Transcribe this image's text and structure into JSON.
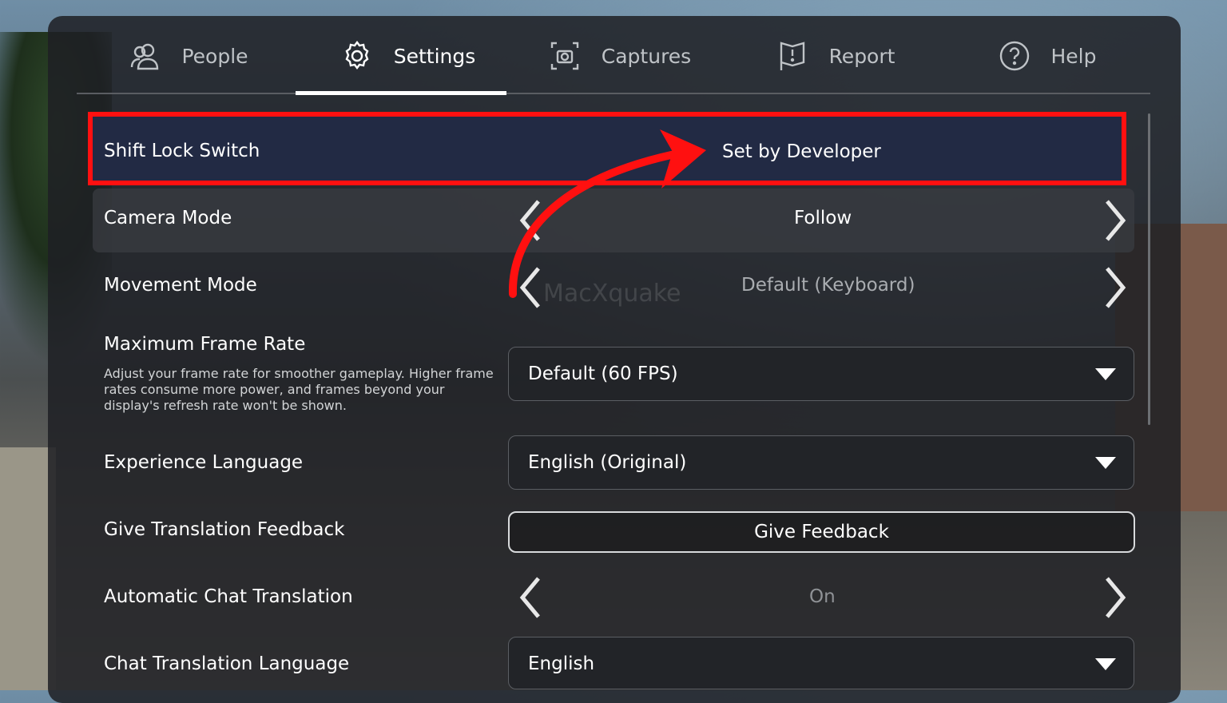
{
  "tabs": [
    {
      "label": "People",
      "icon": "people-icon"
    },
    {
      "label": "Settings",
      "icon": "gear-icon",
      "active": true
    },
    {
      "label": "Captures",
      "icon": "camera-capture-icon"
    },
    {
      "label": "Report",
      "icon": "flag-icon"
    },
    {
      "label": "Help",
      "icon": "help-icon"
    }
  ],
  "settings": {
    "shift_lock": {
      "label": "Shift Lock Switch",
      "value": "Set by Developer"
    },
    "camera_mode": {
      "label": "Camera Mode",
      "value": "Follow"
    },
    "movement_mode": {
      "label": "Movement Mode",
      "value": "Default (Keyboard)"
    },
    "frame_rate": {
      "label": "Maximum Frame Rate",
      "description": "Adjust your frame rate for smoother gameplay. Higher frame rates consume more power, and frames beyond your display's refresh rate won't be shown.",
      "value": "Default (60 FPS)"
    },
    "experience_language": {
      "label": "Experience Language",
      "value": "English (Original)"
    },
    "translation_feedback": {
      "label": "Give Translation Feedback",
      "button": "Give Feedback"
    },
    "auto_chat_translation": {
      "label": "Automatic Chat Translation",
      "value": "On"
    },
    "chat_translation_language": {
      "label": "Chat Translation Language",
      "value": "English"
    }
  },
  "watermark": "MacXquake",
  "colors": {
    "highlight_border": "#ff1010",
    "annotation_arrow": "#ff1010"
  }
}
